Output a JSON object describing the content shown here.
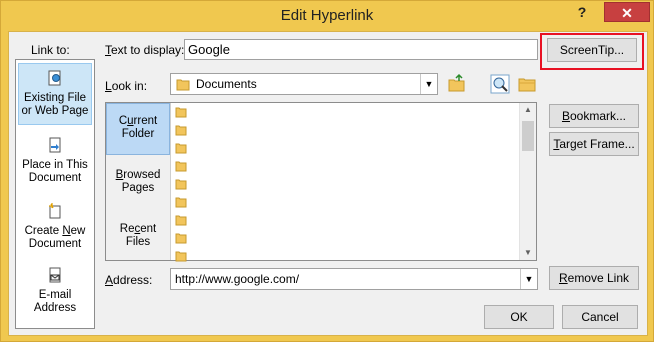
{
  "window": {
    "title": "Edit Hyperlink",
    "help_glyph": "?",
    "close_glyph": "✕"
  },
  "link_to": {
    "label": "Link to:",
    "items": [
      {
        "line1": "Existing File",
        "line2": "or Web Page",
        "selected": true,
        "icon": "globe-page-icon"
      },
      {
        "line1": "Place in This",
        "line2": "Document",
        "selected": false,
        "icon": "document-arrow-icon"
      },
      {
        "line1": "Create New",
        "line2": "Document",
        "selected": false,
        "icon": "new-document-icon"
      },
      {
        "line1": "E-mail",
        "line2": "Address",
        "selected": false,
        "icon": "email-icon"
      }
    ]
  },
  "text_to_display": {
    "label": "Text to display:",
    "value": "Google"
  },
  "screentip_button": "ScreenTip...",
  "look_in": {
    "label": "Look in:",
    "value": "Documents"
  },
  "browse": {
    "side_items": [
      {
        "line1": "Current",
        "line2": "Folder",
        "selected": true
      },
      {
        "line1": "Browsed",
        "line2": "Pages",
        "selected": false
      },
      {
        "line1": "Recent",
        "line2": "Files",
        "selected": false
      }
    ],
    "folder_count": 9
  },
  "right_buttons": {
    "bookmark": "Bookmark...",
    "target_frame": "Target Frame...",
    "remove_link": "Remove Link"
  },
  "address": {
    "label": "Address:",
    "value": "http://www.google.com/"
  },
  "footer": {
    "ok": "OK",
    "cancel": "Cancel"
  },
  "colors": {
    "titlebar": "#f0c84f",
    "close": "#c74040",
    "highlight": "#e81123",
    "selected": "#cde6f7"
  }
}
